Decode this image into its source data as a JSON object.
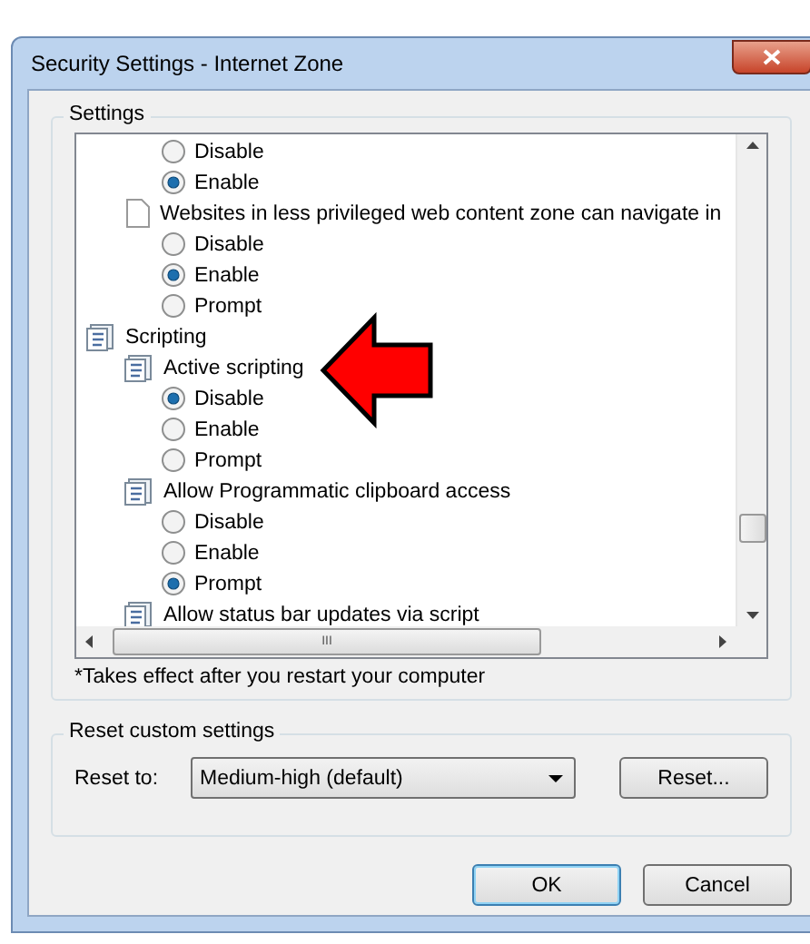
{
  "window": {
    "title": "Security Settings - Internet Zone"
  },
  "settings": {
    "legend": "Settings",
    "tree": [
      {
        "kind": "radio",
        "label": "Disable",
        "selected": false
      },
      {
        "kind": "radio",
        "label": "Enable",
        "selected": true
      },
      {
        "kind": "document",
        "label": "Websites in less privileged web content zone can navigate in",
        "children": [
          {
            "kind": "radio",
            "label": "Disable",
            "selected": false
          },
          {
            "kind": "radio",
            "label": "Enable",
            "selected": true
          },
          {
            "kind": "radio",
            "label": "Prompt",
            "selected": false
          }
        ]
      },
      {
        "kind": "category",
        "label": "Scripting",
        "children": [
          {
            "kind": "script",
            "label": "Active scripting",
            "children": [
              {
                "kind": "radio",
                "label": "Disable",
                "selected": true
              },
              {
                "kind": "radio",
                "label": "Enable",
                "selected": false
              },
              {
                "kind": "radio",
                "label": "Prompt",
                "selected": false
              }
            ]
          },
          {
            "kind": "script",
            "label": "Allow Programmatic clipboard access",
            "children": [
              {
                "kind": "radio",
                "label": "Disable",
                "selected": false
              },
              {
                "kind": "radio",
                "label": "Enable",
                "selected": false
              },
              {
                "kind": "radio",
                "label": "Prompt",
                "selected": true
              }
            ]
          },
          {
            "kind": "script",
            "label": "Allow status bar updates via script"
          }
        ]
      }
    ],
    "scroll_h": "III",
    "note": "*Takes effect after you restart your computer"
  },
  "reset": {
    "legend": "Reset custom settings",
    "label": "Reset to:",
    "value": "Medium-high (default)",
    "button": "Reset..."
  },
  "buttons": [
    {
      "label": "OK",
      "default": true
    },
    {
      "label": "Cancel",
      "default": false
    }
  ]
}
